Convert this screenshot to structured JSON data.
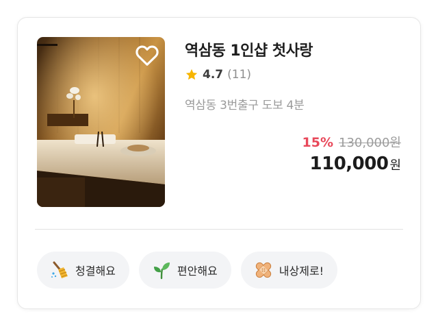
{
  "listing": {
    "title": "역삼동 1인샵 첫사랑",
    "rating": "4.7",
    "review_count": "(11)",
    "location": "역삼동 3번출구 도보 4분",
    "discount": "15%",
    "original_price": "130,000원",
    "final_price": "110,000",
    "currency": "원",
    "favorited": false
  },
  "tags": [
    {
      "label": "청결해요",
      "icon": "broom-icon"
    },
    {
      "label": "편안해요",
      "icon": "sprout-icon"
    },
    {
      "label": "내상제로!",
      "icon": "bandage-icon"
    }
  ],
  "colors": {
    "discount": "#e8485a",
    "star": "#f7b500",
    "tag_bg": "#f3f4f6"
  }
}
